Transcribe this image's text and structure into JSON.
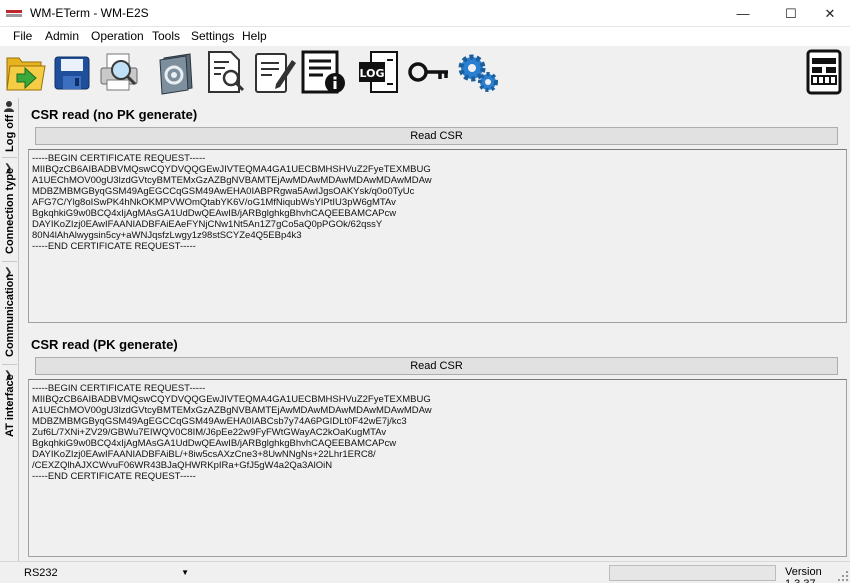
{
  "window": {
    "title": "WM-ETerm - WM-E2S",
    "minimize_glyph": "—",
    "maximize_glyph": "☐",
    "close_glyph": "✕"
  },
  "menu": {
    "items": [
      "File",
      "Admin",
      "Operation",
      "Tools",
      "Settings",
      "Help"
    ]
  },
  "toolbar": {
    "buttons": [
      {
        "icon": "open-folder-icon"
      },
      {
        "icon": "save-icon"
      },
      {
        "icon": "print-preview-icon"
      },
      {
        "icon": "config-pages-icon"
      },
      {
        "icon": "document-search-icon"
      },
      {
        "icon": "edit-document-icon"
      },
      {
        "icon": "document-info-icon"
      },
      {
        "icon": "log-icon",
        "label": "LOG"
      },
      {
        "icon": "key-icon"
      },
      {
        "icon": "settings-gears-icon"
      },
      {
        "icon": "meter-icon"
      }
    ]
  },
  "sidebar": {
    "tabs": [
      {
        "label": "Log off"
      },
      {
        "label": "Connection type"
      },
      {
        "label": "Communication"
      },
      {
        "label": "AT interface"
      }
    ]
  },
  "panels": [
    {
      "title": "CSR read (no PK generate)",
      "button_label": "Read CSR",
      "csr_lines": [
        "-----BEGIN CERTIFICATE REQUEST-----",
        "MIIBQzCB6AIBADBVMQswCQYDVQQGEwJIVTEQMA4GA1UECBMHSHVuZ2FyeTEXMBUG",
        "A1UEChMOV00gU3lzdGVtcyBMTEMxGzAZBgNVBAMTEjAwMDAwMDAwMDAwMDAwMDAw",
        "MDBZMBMGByqGSM49AgEGCCqGSM49AwEHA0IABPRgwa5AwIJgsOAKYsk/q0o0TyUc",
        "AFG7C/Ylg8oISwPK4hNkOKMPVWOmQtabYK6V/oG1MfNiqubWsYIPtIU3pW6gMTAv",
        "BgkqhkiG9w0BCQ4xIjAgMAsGA1UdDwQEAwIB/jARBglghkgBhvhCAQEEBAMCAPcw",
        "DAYIKoZIzj0EAwIFAANIADBFAiEAeFYNjCNw1Nt5An1Z7gCo5aQ0pPGOk/62qssY",
        "80N4lAhAlwygsin5cy+aWNJqsfzLwgy1z98stSCYZe4Q5EBp4k3",
        "-----END CERTIFICATE REQUEST-----"
      ]
    },
    {
      "title": "CSR read (PK generate)",
      "button_label": "Read CSR",
      "csr_lines": [
        "-----BEGIN CERTIFICATE REQUEST-----",
        "MIIBQzCB6AIBADBVMQswCQYDVQQGEwJIVTEQMA4GA1UECBMHSHVuZ2FyeTEXMBUG",
        "A1UEChMOV00gU3lzdGVtcyBMTEMxGzAZBgNVBAMTEjAwMDAwMDAwMDAwMDAwMDAw",
        "MDBZMBMGByqGSM49AgEGCCqGSM49AwEHA0IABCsb7y74A6PGIDLt0F42wE7j/kc3",
        "Zuf6L/7XNi+ZV29/GBWu7EIWQV0C8IM/J6pEe22w9FyFWtGWayAC2kOaKugMTAv",
        "BgkqhkiG9w0BCQ4xIjAgMAsGA1UdDwQEAwIB/jARBglghkgBhvhCAQEEBAMCAPcw",
        "DAYIKoZIzj0EAwIFAANIADBFAiBL/+8iw5csAXzCne3+8UwNNgNs+22Lhr1ERC8/",
        "/CEXZQlhAJXCWvuF06WR43BJaQHWRKpIRa+GfJ5gW4a2Qa3AlOiN",
        "-----END CERTIFICATE REQUEST-----"
      ]
    }
  ],
  "status": {
    "port": "RS232",
    "version": "Version 1.3.37"
  }
}
